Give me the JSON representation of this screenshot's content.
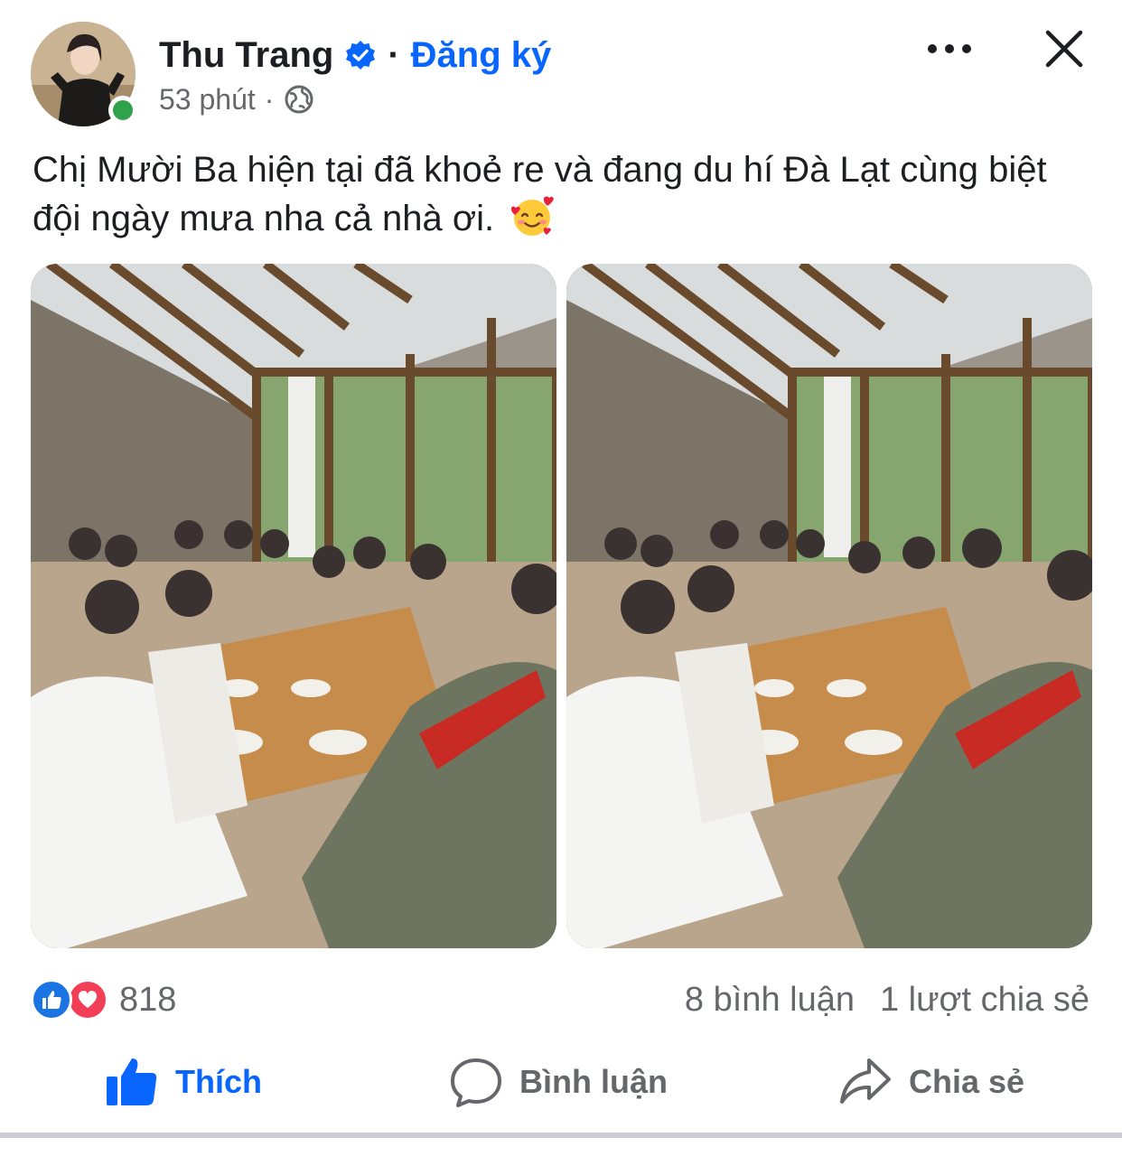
{
  "post": {
    "author": {
      "name": "Thu Trang",
      "verified": true,
      "online": true,
      "avatar_icon": "profile-photo"
    },
    "separator": "·",
    "follow_label": "Đăng ký",
    "time": "53 phút",
    "privacy_icon": "globe-icon",
    "text": "Chị Mười Ba hiện tại đã khoẻ re và đang du hí Đà Lạt cùng biệt đội ngày mưa nha cả nhà ơi.",
    "emoji": "smiling-face-with-hearts",
    "photos": [
      {
        "id": "photo-1",
        "icon": "group-photo"
      },
      {
        "id": "photo-2",
        "icon": "group-photo"
      }
    ]
  },
  "stats": {
    "reaction_count": "818",
    "reaction_types": [
      "like",
      "love"
    ],
    "comments": "8 bình luận",
    "shares": "1 lượt chia sẻ"
  },
  "actions": {
    "like": "Thích",
    "comment": "Bình luận",
    "share": "Chia sẻ"
  },
  "colors": {
    "accent": "#0866ff",
    "text_primary": "#1c1e21",
    "text_secondary": "#65676b",
    "online": "#31a24c",
    "like": "#1b74e4",
    "love": "#f33e58"
  }
}
